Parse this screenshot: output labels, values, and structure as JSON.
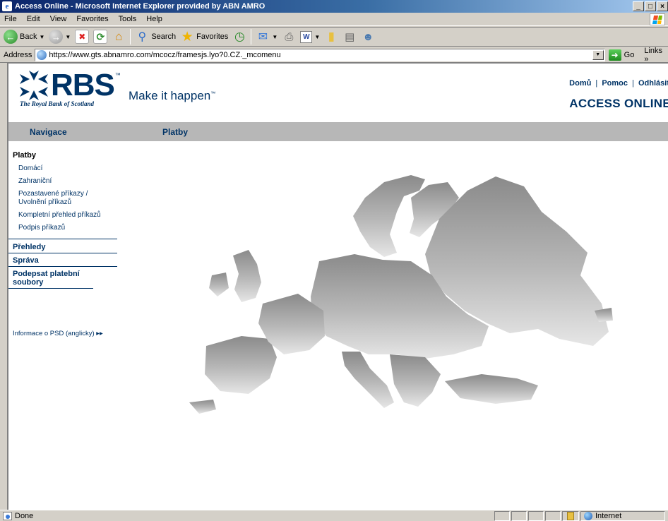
{
  "window": {
    "title": "Access Online - Microsoft Internet Explorer provided by ABN AMRO",
    "minimize": "_",
    "maximize": "□",
    "close": "×"
  },
  "menu": [
    "File",
    "Edit",
    "View",
    "Favorites",
    "Tools",
    "Help"
  ],
  "toolbar": {
    "back_label": "Back",
    "search_label": "Search",
    "favorites_label": "Favorites"
  },
  "address": {
    "label": "Address",
    "url": "https://www.gts.abnamro.com/mcocz/framesjs.lyo?0.CZ._mcomenu",
    "go_label": "Go",
    "links_label": "Links »"
  },
  "site": {
    "logo_text": "RBS",
    "logo_tm": "™",
    "logo_sub": "The Royal Bank of Scotland",
    "tagline": "Make it happen",
    "tagline_tm": "™",
    "top_links": [
      "Domů",
      "Pomoc",
      "Odhlásit"
    ],
    "top_link_sep": "|",
    "product_name": "ACCESS ONLINE"
  },
  "nav": {
    "left": "Navigace",
    "right": "Platby"
  },
  "sidebar": {
    "title": "Platby",
    "sub_items": [
      "Domácí",
      "Zahraniční",
      "Pozastavené příkazy / Uvolnění příkazů",
      "Kompletní přehled příkazů",
      "Podpis příkazů"
    ],
    "sections": [
      "Přehledy",
      "Správa",
      "Podepsat platební soubory"
    ],
    "psd_link": "Informace o PSD (anglicky) ▸▸"
  },
  "status": {
    "text": "Done",
    "zone": "Internet"
  },
  "colors": {
    "brand": "#003366",
    "nav_bg": "#b7b7b7",
    "title_bar": "#0a246a"
  }
}
